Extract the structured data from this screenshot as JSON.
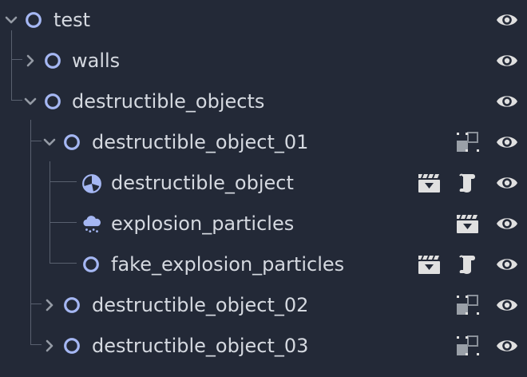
{
  "scene_tree": {
    "nodes": [
      {
        "label": "test",
        "expand": "expanded",
        "node_icon": "node-circle-icon",
        "actions": [
          "visibility-eye-icon"
        ]
      },
      {
        "label": "walls",
        "expand": "collapsed",
        "node_icon": "node-circle-icon",
        "actions": [
          "visibility-eye-icon"
        ]
      },
      {
        "label": "destructible_objects",
        "expand": "expanded",
        "node_icon": "node-circle-icon",
        "actions": [
          "visibility-eye-icon"
        ]
      },
      {
        "label": "destructible_object_01",
        "expand": "expanded",
        "node_icon": "node-circle-icon",
        "actions": [
          "editable-children-icon",
          "visibility-eye-icon"
        ]
      },
      {
        "label": "destructible_object",
        "expand": "none",
        "node_icon": "rigid-body-ball-icon",
        "actions": [
          "open-in-editor-clapper-icon",
          "script-scroll-icon",
          "visibility-eye-icon"
        ]
      },
      {
        "label": "explosion_particles",
        "expand": "none",
        "node_icon": "particles-cloud-icon",
        "actions": [
          "open-in-editor-clapper-icon",
          "visibility-eye-icon"
        ]
      },
      {
        "label": "fake_explosion_particles",
        "expand": "none",
        "node_icon": "node-circle-icon",
        "actions": [
          "open-in-editor-clapper-icon",
          "script-scroll-icon",
          "visibility-eye-icon"
        ]
      },
      {
        "label": "destructible_object_02",
        "expand": "collapsed",
        "node_icon": "node-circle-icon",
        "actions": [
          "editable-children-icon",
          "visibility-eye-icon"
        ]
      },
      {
        "label": "destructible_object_03",
        "expand": "collapsed",
        "node_icon": "node-circle-icon",
        "actions": [
          "editable-children-icon",
          "visibility-eye-icon"
        ]
      }
    ]
  },
  "colors": {
    "background": "#232937",
    "text": "#d5d9e0",
    "node_icon": "#a5b7f3",
    "arrow": "#959ba5",
    "guide_line": "#59606f",
    "action_icon": "#e0e0e0"
  }
}
